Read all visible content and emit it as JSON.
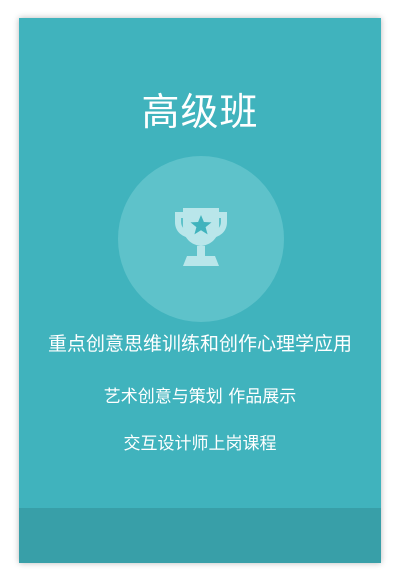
{
  "card": {
    "title": "高级班",
    "icon": "trophy-star-icon",
    "line1": "重点创意思维训练和创作心理学应用",
    "line2": "艺术创意与策划  作品展示",
    "line3": "交互设计师上岗课程",
    "colors": {
      "background": "#40b3bd",
      "circle": "#5ec2ca",
      "icon": "#b9e6ea",
      "bottom_band": "#389fa8",
      "text": "#ffffff"
    }
  }
}
